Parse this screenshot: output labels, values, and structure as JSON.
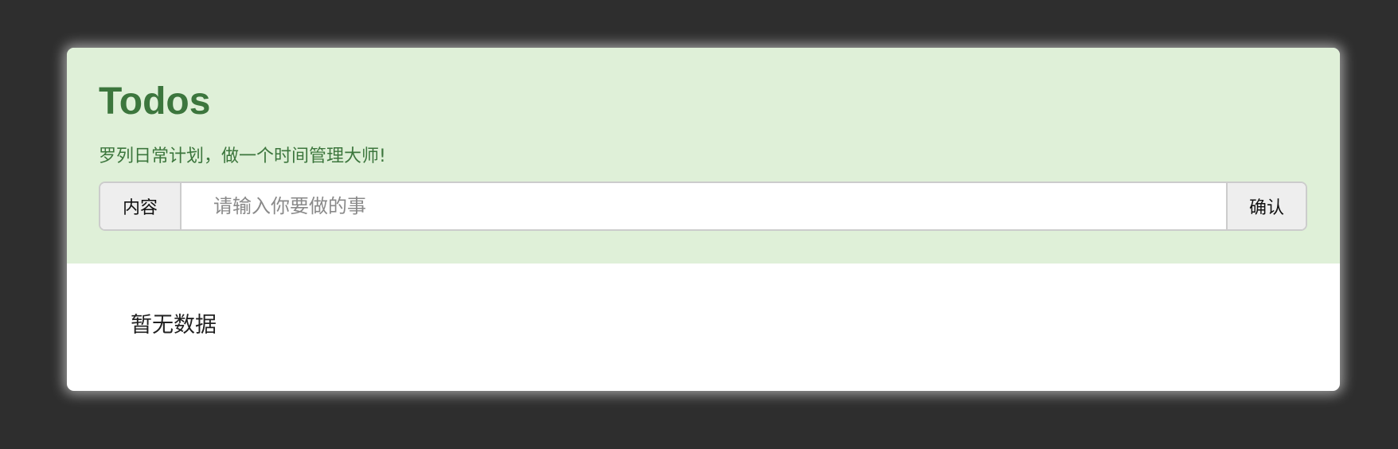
{
  "header": {
    "title": "Todos",
    "subtitle": "罗列日常计划，做一个时间管理大师!"
  },
  "form": {
    "addon_label": "内容",
    "input_value": "",
    "input_placeholder": "请输入你要做的事",
    "confirm_label": "确认"
  },
  "list": {
    "items": [],
    "empty_text": "暂无数据"
  },
  "colors": {
    "header_background": "#dff0d8",
    "title_text": "#3c763d",
    "page_background": "#2e2e2e"
  }
}
